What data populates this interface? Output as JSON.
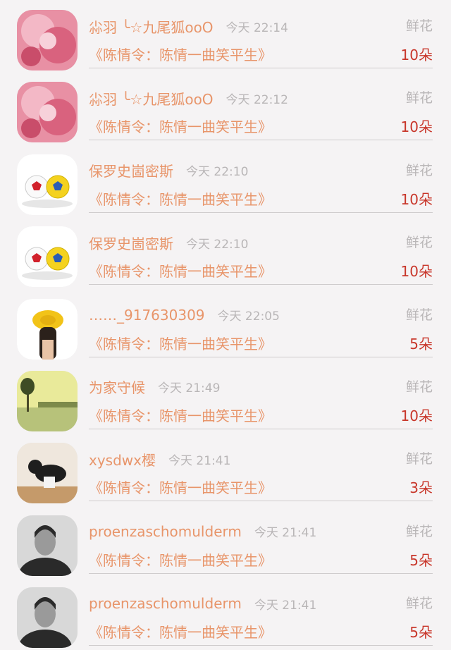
{
  "rows": [
    {
      "name": "尛羽 ╰☆九尾狐ooO",
      "time": "今天 22:14",
      "gift": "鲜花",
      "book": "《陈情令：陈情一曲笑平生》",
      "count": "10朵",
      "avatar": "pink-flower"
    },
    {
      "name": "尛羽 ╰☆九尾狐ooO",
      "time": "今天 22:12",
      "gift": "鲜花",
      "book": "《陈情令：陈情一曲笑平生》",
      "count": "10朵",
      "avatar": "pink-flower"
    },
    {
      "name": "保罗史崮密斯",
      "time": "今天 22:10",
      "gift": "鲜花",
      "book": "《陈情令：陈情一曲笑平生》",
      "count": "10朵",
      "avatar": "soccer-balls"
    },
    {
      "name": "保罗史崮密斯",
      "time": "今天 22:10",
      "gift": "鲜花",
      "book": "《陈情令：陈情一曲笑平生》",
      "count": "10朵",
      "avatar": "soccer-balls"
    },
    {
      "name": "……_917630309",
      "time": "今天 22:05",
      "gift": "鲜花",
      "book": "《陈情令：陈情一曲笑平生》",
      "count": "5朵",
      "avatar": "yellow-hat-girl"
    },
    {
      "name": "为家守候",
      "time": "今天 21:49",
      "gift": "鲜花",
      "book": "《陈情令：陈情一曲笑平生》",
      "count": "10朵",
      "avatar": "lake-landscape"
    },
    {
      "name": "xysdwx樱",
      "time": "今天 21:41",
      "gift": "鲜花",
      "book": "《陈情令：陈情一曲笑平生》",
      "count": "3朵",
      "avatar": "cat"
    },
    {
      "name": "proenzaschomulderm",
      "time": "今天 21:41",
      "gift": "鲜花",
      "book": "《陈情令：陈情一曲笑平生》",
      "count": "5朵",
      "avatar": "man-portrait"
    },
    {
      "name": "proenzaschomulderm",
      "time": "今天 21:41",
      "gift": "鲜花",
      "book": "《陈情令：陈情一曲笑平生》",
      "count": "5朵",
      "avatar": "man-portrait"
    }
  ]
}
